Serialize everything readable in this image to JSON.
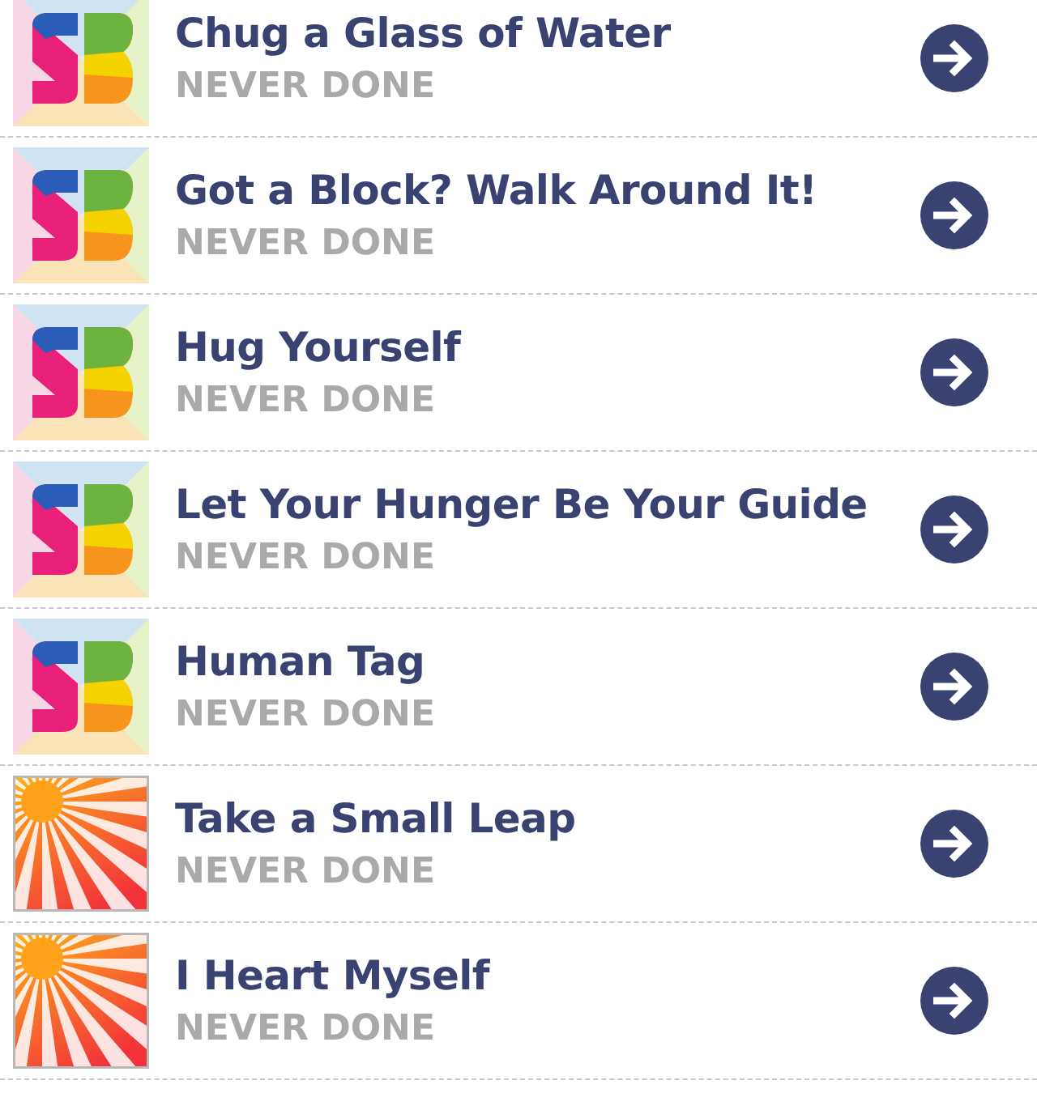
{
  "items": [
    {
      "title": "Chug a Glass of Water",
      "status": "NEVER DONE",
      "kind": "rainbow"
    },
    {
      "title": "Got a Block? Walk Around It!",
      "status": "NEVER DONE",
      "kind": "rainbow"
    },
    {
      "title": "Hug Yourself",
      "status": "NEVER DONE",
      "kind": "rainbow"
    },
    {
      "title": "Let Your Hunger Be Your Guide",
      "status": "NEVER DONE",
      "kind": "rainbow"
    },
    {
      "title": "Human Tag",
      "status": "NEVER DONE",
      "kind": "rainbow"
    },
    {
      "title": "Take a Small Leap",
      "status": "NEVER DONE",
      "kind": "sunburst"
    },
    {
      "title": "I Heart Myself",
      "status": "NEVER DONE",
      "kind": "sunburst"
    }
  ]
}
